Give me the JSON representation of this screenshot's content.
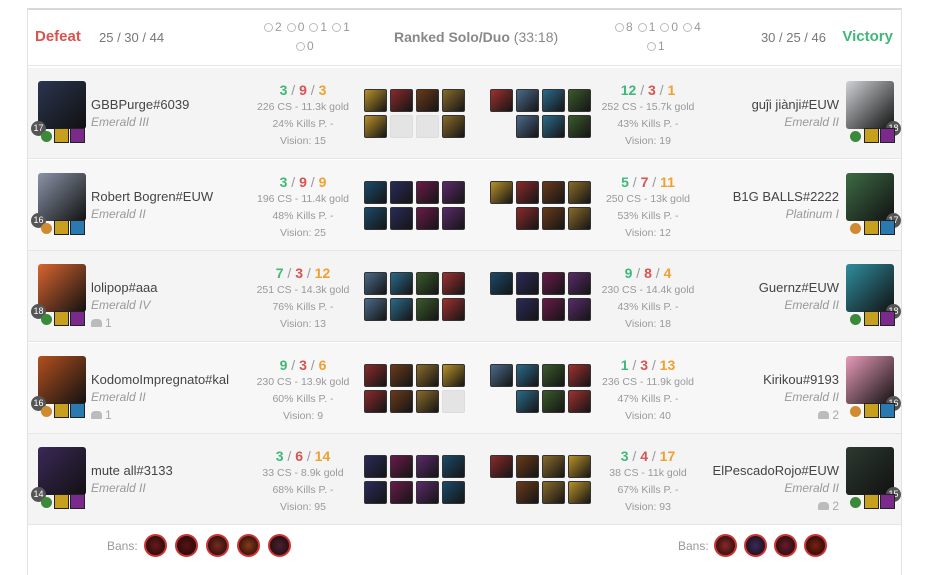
{
  "header": {
    "left_result": "Defeat",
    "left_kda": "25 / 30 / 44",
    "left_obj_1": "2",
    "left_obj_2": "0",
    "left_obj_3": "1",
    "left_obj_4": "1",
    "left_obj_5": "0",
    "queue": "Ranked Solo/Duo",
    "duration": "(33:18)",
    "right_obj_1": "8",
    "right_obj_2": "1",
    "right_obj_3": "0",
    "right_obj_4": "4",
    "right_obj_5": "1",
    "right_kda": "30 / 25 / 46",
    "right_result": "Victory"
  },
  "rows": [
    {
      "left": {
        "name": "GBBPurge#6039",
        "rank": "Emerald III",
        "party": "",
        "level": "17",
        "k": "3",
        "d": "9",
        "a": "3",
        "cs": "226 CS - 11.3k gold",
        "kp": "24% Kills P. -",
        "vision": "Vision: 15",
        "champ_color": "#2a3550"
      },
      "right": {
        "name": "guĵi jiànji#EUW",
        "rank": "Emerald II",
        "party": "",
        "level": "18",
        "k": "12",
        "d": "3",
        "a": "1",
        "cs": "252 CS - 15.7k gold",
        "kp": "43% Kills P. -",
        "vision": "Vision: 19",
        "champ_color": "#cfd3d6"
      }
    },
    {
      "left": {
        "name": "Robert Bogren#EUW",
        "rank": "Emerald II",
        "party": "",
        "level": "16",
        "k": "3",
        "d": "9",
        "a": "9",
        "cs": "196 CS - 11.4k gold",
        "kp": "48% Kills P. -",
        "vision": "Vision: 25",
        "champ_color": "#8a94a8"
      },
      "right": {
        "name": "B1G BALLS#2222",
        "rank": "Platinum I",
        "party": "",
        "level": "17",
        "k": "5",
        "d": "7",
        "a": "11",
        "cs": "250 CS - 13k gold",
        "kp": "53% Kills P. -",
        "vision": "Vision: 12",
        "champ_color": "#3d6b45"
      }
    },
    {
      "left": {
        "name": "lolipop#aaa",
        "rank": "Emerald IV",
        "party": "1",
        "level": "18",
        "k": "7",
        "d": "3",
        "a": "12",
        "cs": "251 CS - 14.3k gold",
        "kp": "76% Kills P. -",
        "vision": "Vision: 13",
        "champ_color": "#d9652f"
      },
      "right": {
        "name": "Guernz#EUW",
        "rank": "Emerald II",
        "party": "",
        "level": "18",
        "k": "9",
        "d": "8",
        "a": "4",
        "cs": "230 CS - 14.4k gold",
        "kp": "43% Kills P. -",
        "vision": "Vision: 18",
        "champ_color": "#2f8ea0"
      }
    },
    {
      "left": {
        "name": "KodomoImpregnato#kal",
        "rank": "Emerald II",
        "party": "1",
        "level": "16",
        "k": "9",
        "d": "3",
        "a": "6",
        "cs": "230 CS - 13.9k gold",
        "kp": "60% Kills P. -",
        "vision": "Vision: 9",
        "champ_color": "#b3501e"
      },
      "right": {
        "name": "Kirikou#9193",
        "rank": "Emerald II",
        "party": "2",
        "level": "16",
        "k": "1",
        "d": "3",
        "a": "13",
        "cs": "236 CS - 11.9k gold",
        "kp": "47% Kills P. -",
        "vision": "Vision: 40",
        "champ_color": "#e89ab8"
      }
    },
    {
      "left": {
        "name": "mute all#3133",
        "rank": "Emerald II",
        "party": "",
        "level": "14",
        "k": "3",
        "d": "6",
        "a": "14",
        "cs": "33 CS - 8.9k gold",
        "kp": "68% Kills P. -",
        "vision": "Vision: 95",
        "champ_color": "#3b2858"
      },
      "right": {
        "name": "ElPescadoRojo#EUW",
        "rank": "Emerald II",
        "party": "2",
        "level": "15",
        "k": "3",
        "d": "4",
        "a": "17",
        "cs": "38 CS - 11k gold",
        "kp": "67% Kills P. -",
        "vision": "Vision: 93",
        "champ_color": "#2c3a30"
      }
    }
  ],
  "bans": {
    "label": "Bans:",
    "left_colors": [
      "#6a1818",
      "#5a1212",
      "#7a2a20",
      "#8a3a18",
      "#4a2030"
    ],
    "right_colors": [
      "#8a2828",
      "#3a2a5a",
      "#6a1a2a",
      "#7a2010"
    ]
  },
  "item_palette": [
    "#b8902a",
    "#2a6a8a",
    "#5a2a6a",
    "#8a2a2a",
    "#3a5a2a",
    "#1a4a6a",
    "#6a3a1a",
    "#a03030",
    "#2a2a5a",
    "#8a6a2a",
    "#4a6a8a",
    "#6a1a4a"
  ]
}
